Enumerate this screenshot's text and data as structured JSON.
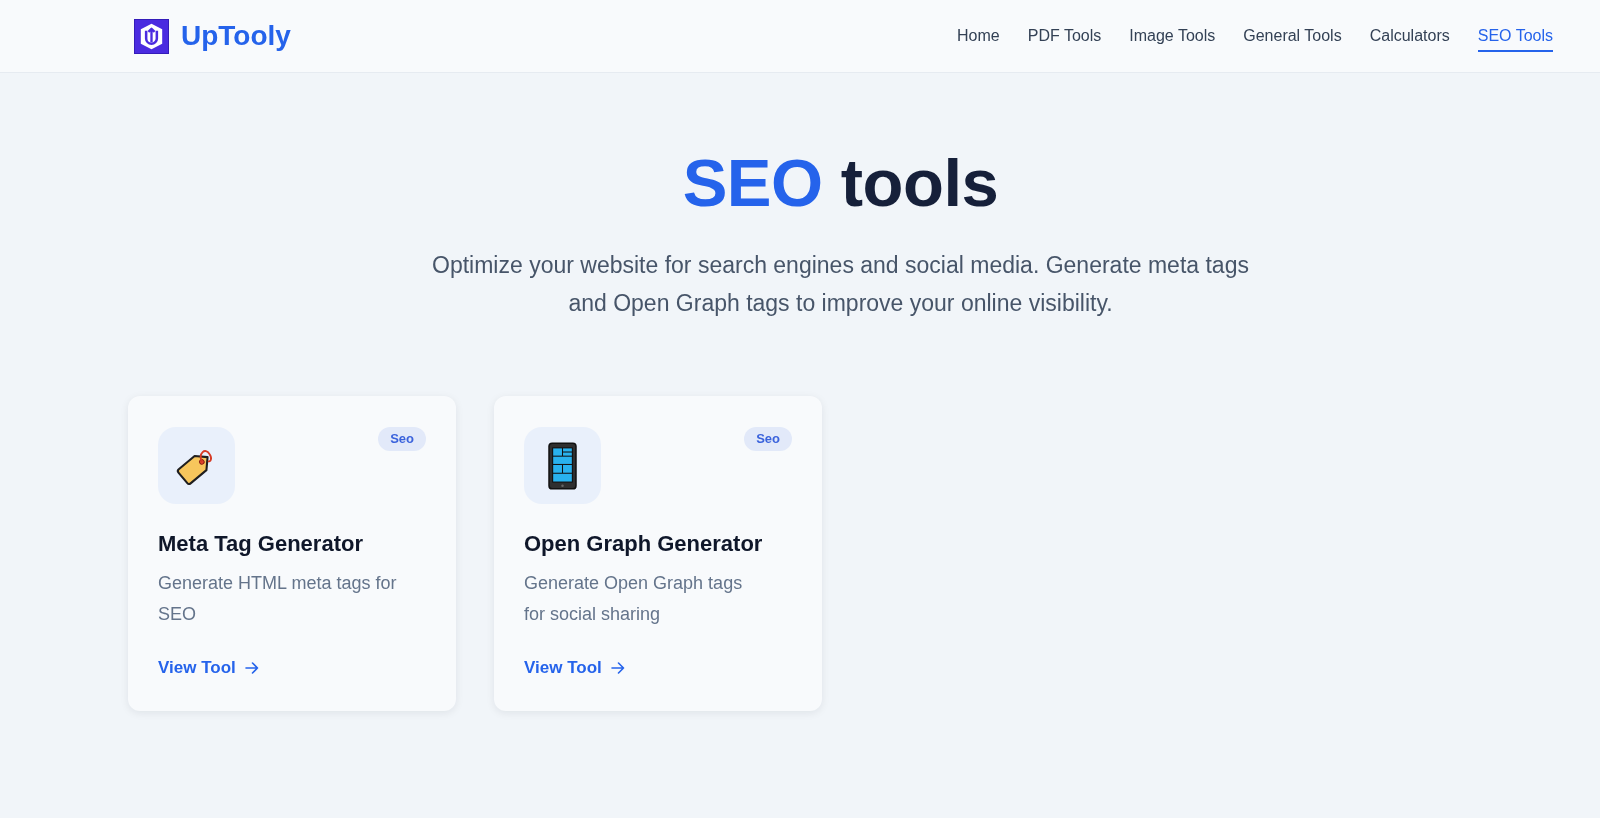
{
  "header": {
    "logo": "UpTooly",
    "nav": [
      {
        "label": "Home",
        "selected": false
      },
      {
        "label": "PDF Tools",
        "selected": false
      },
      {
        "label": "Image Tools",
        "selected": false
      },
      {
        "label": "General Tools",
        "selected": false
      },
      {
        "label": "Calculators",
        "selected": false
      },
      {
        "label": "SEO Tools",
        "selected": true
      }
    ]
  },
  "hero": {
    "title": {
      "highlight": "SEO",
      "rest": "tools"
    },
    "subtitle": "Optimize your website for search engines and social media. Generate meta tags and Open Graph tags to improve your online visibility."
  },
  "cards": [
    {
      "title": "Meta Tag Generator",
      "description": "Generate HTML meta tags for SEO",
      "badge": "Seo",
      "link": "View Tool"
    },
    {
      "title": "Open Graph Generator",
      "description": "Generate Open Graph tags for social sharing",
      "badge": "Seo",
      "link": "View Tool"
    }
  ]
}
